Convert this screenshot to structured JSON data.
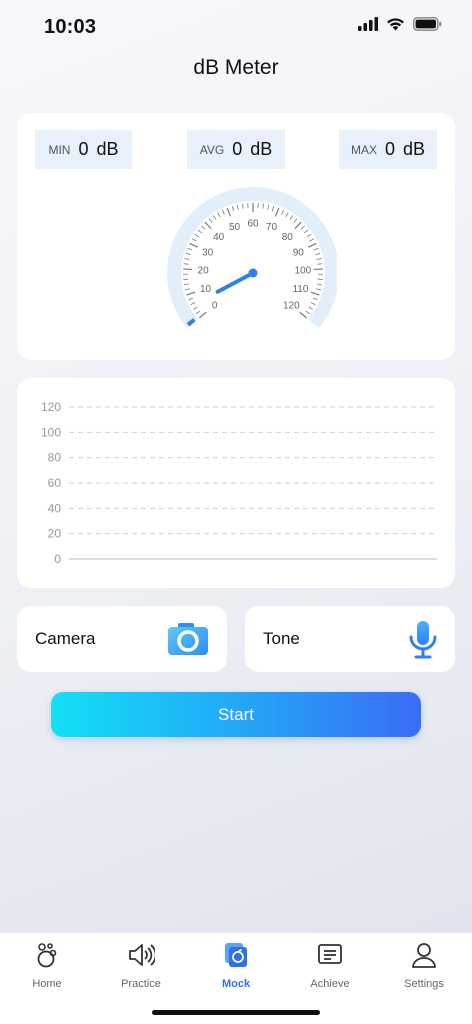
{
  "status": {
    "time": "10:03"
  },
  "header": {
    "title": "dB Meter"
  },
  "stats": {
    "min": {
      "key": "MIN",
      "value": "0",
      "unit": "dB"
    },
    "avg": {
      "key": "AVG",
      "value": "0",
      "unit": "dB"
    },
    "max": {
      "key": "MAX",
      "value": "0",
      "unit": "dB"
    }
  },
  "gauge": {
    "labels": [
      "0",
      "10",
      "20",
      "30",
      "40",
      "50",
      "60",
      "70",
      "80",
      "90",
      "100",
      "110",
      "120"
    ],
    "min": 0,
    "max": 120,
    "value": 0
  },
  "chart_data": {
    "type": "line",
    "y_ticks": [
      "120",
      "100",
      "80",
      "60",
      "40",
      "20",
      "0"
    ],
    "ylim": [
      0,
      120
    ],
    "series": [],
    "grid": true
  },
  "actions": {
    "camera_label": "Camera",
    "tone_label": "Tone",
    "start_label": "Start"
  },
  "tabs": [
    {
      "label": "Home"
    },
    {
      "label": "Practice"
    },
    {
      "label": "Mock"
    },
    {
      "label": "Achieve"
    },
    {
      "label": "Settings"
    }
  ],
  "colors": {
    "accent": "#2f6fec",
    "gauge_needle": "#2f80ed",
    "stat_bg": "#e6f1fb"
  }
}
